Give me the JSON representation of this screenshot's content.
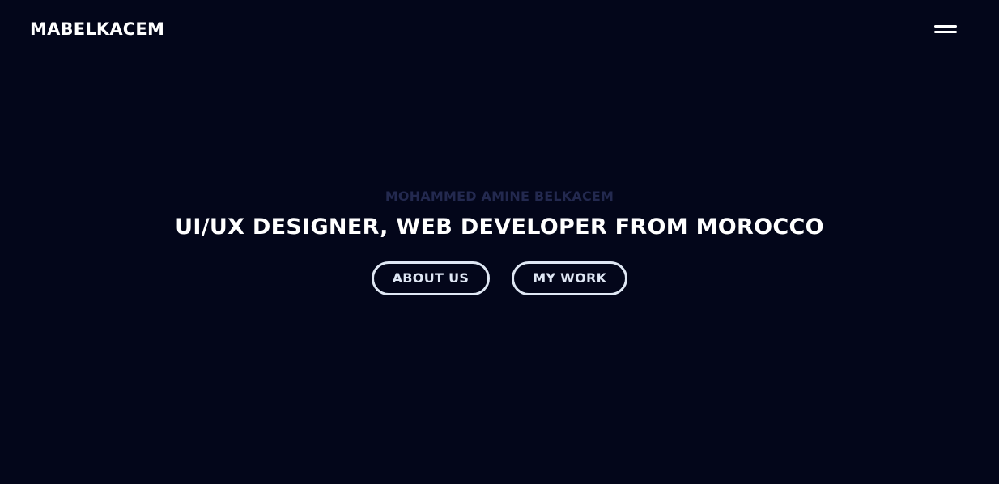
{
  "header": {
    "logo_text": "MABELKACEM",
    "menu_icon": "hamburger-menu-icon"
  },
  "hero": {
    "kicker": "MOHAMMED AMINE BELKACEM",
    "title": "UI/UX DESIGNER, WEB DEVELOPER FROM MOROCCO"
  },
  "actions": [
    {
      "label": "ABOUT US"
    },
    {
      "label": "MY WORK"
    }
  ],
  "colors": {
    "background": "#03061a",
    "primary_text": "#ffffff",
    "muted_text": "#23294f",
    "button_outline": "#dfe7f4"
  }
}
